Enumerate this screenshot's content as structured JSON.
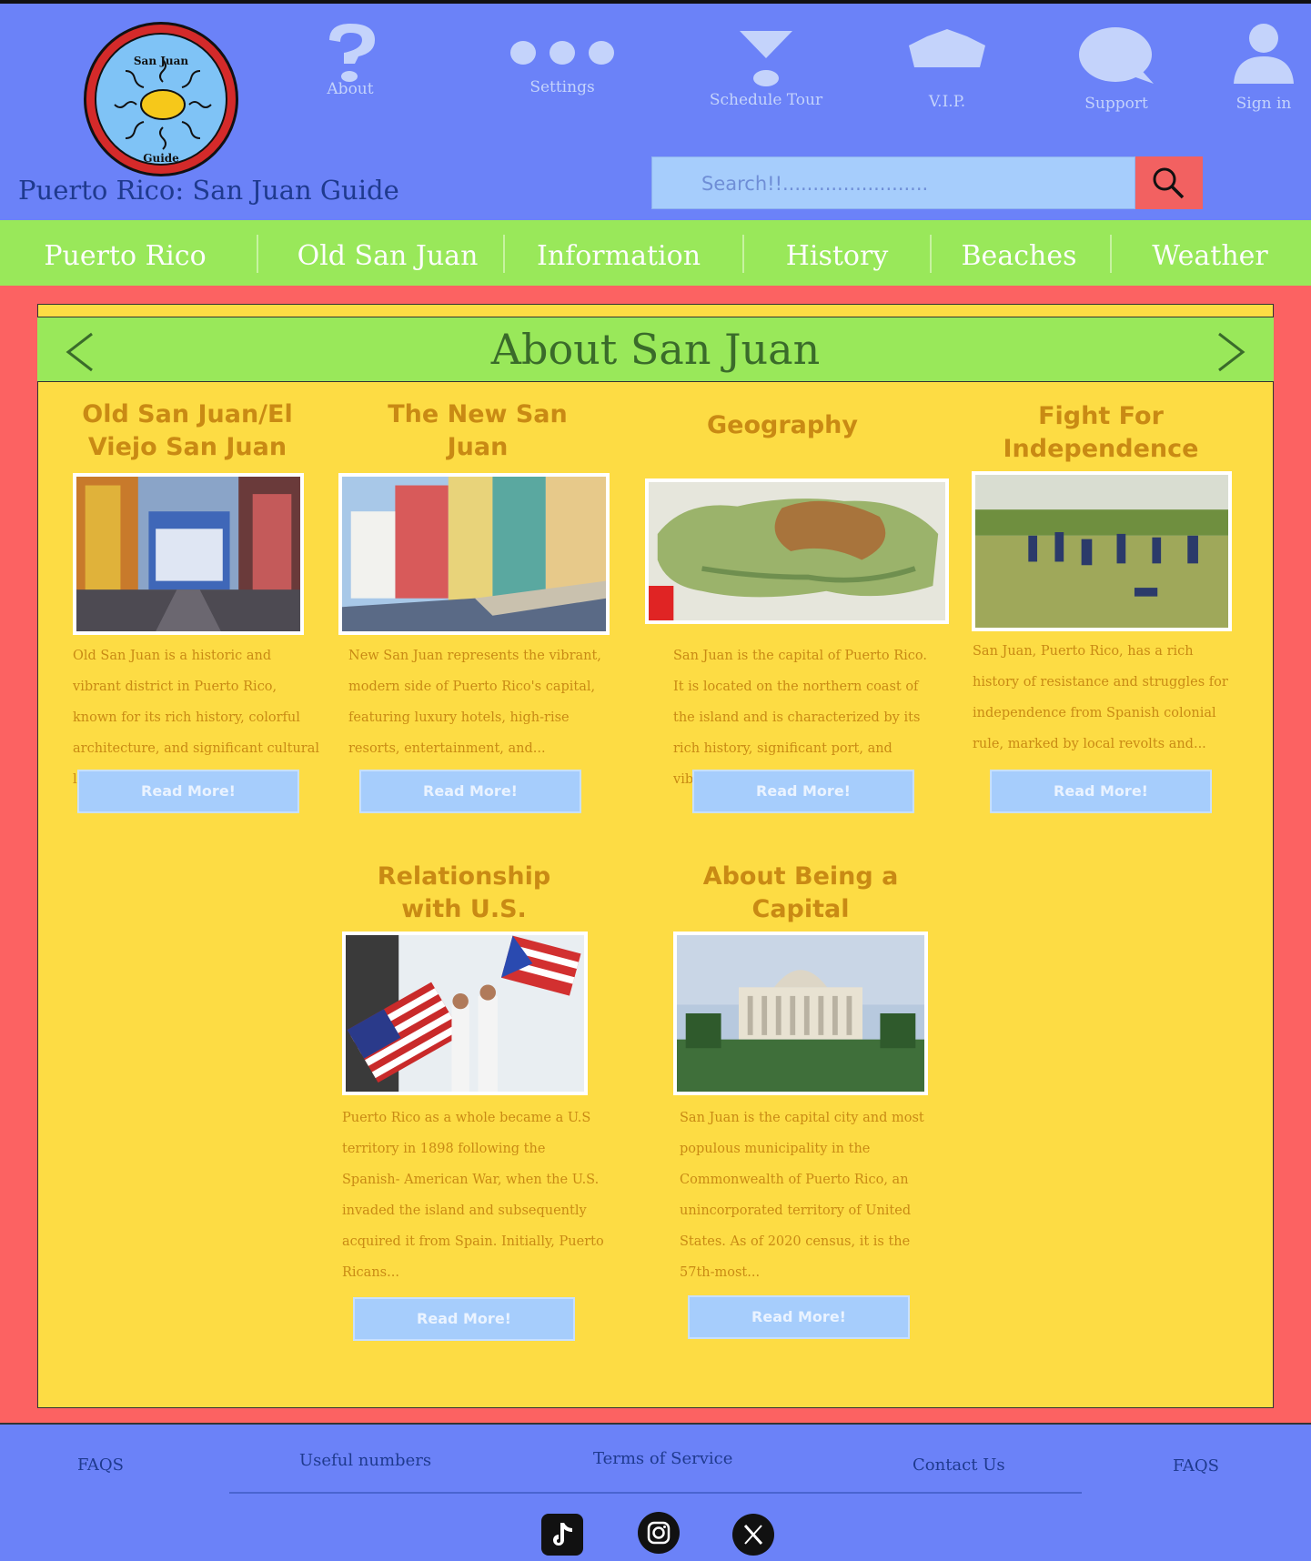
{
  "header": {
    "site_title": "Puerto Rico: San Juan Guide",
    "logo_text_top": "San Juan",
    "logo_text_bottom": "Guide",
    "top_nav": [
      {
        "label": "About",
        "icon": "question-icon"
      },
      {
        "label": "Settings",
        "icon": "ellipsis-icon"
      },
      {
        "label": "Schedule Tour",
        "icon": "tour-icon"
      },
      {
        "label": "V.I.P.",
        "icon": "crown-icon"
      },
      {
        "label": "Support",
        "icon": "chat-bubble-icon"
      },
      {
        "label": "Sign in",
        "icon": "user-icon"
      }
    ],
    "search_placeholder": "Search!!........................"
  },
  "main_nav": [
    "Puerto Rico",
    "Old San Juan",
    "Information",
    "History",
    "Beaches",
    "Weather"
  ],
  "content": {
    "title": "About San Juan",
    "read_more_label": "Read More!",
    "cards": [
      {
        "title": "Old San Juan/El Viejo San Juan",
        "text": "Old San Juan is a historic and vibrant district in Puerto Rico, known for its rich history, colorful architecture, and significant cultural landmarks..."
      },
      {
        "title": "The New San Juan",
        "text": "New San Juan represents the vibrant, modern side of Puerto Rico's capital, featuring luxury hotels, high-rise resorts, entertainment, and..."
      },
      {
        "title": "Geography",
        "text": "San Juan is the capital of Puerto Rico. It is located on the northern coast of the island and is characterized by its rich history, significant port, and vibrant..."
      },
      {
        "title": "Fight For Independence",
        "text": "San Juan, Puerto Rico, has a rich history of resistance and struggles for independence from Spanish colonial rule, marked by local revolts and..."
      },
      {
        "title": "Relationship with U.S.",
        "text": "Puerto Rico as a whole became a U.S territory in 1898 following the Spanish- American War, when the U.S. invaded the island and subsequently acquired it from Spain. Initially, Puerto Ricans..."
      },
      {
        "title": "About Being a Capital",
        "text": "San Juan is the capital city and most populous municipality in the Commonwealth of Puerto Rico, an unincorporated territory of United States. As of 2020 census, it is the 57th-most..."
      }
    ]
  },
  "footer": {
    "links": [
      "FAQS",
      "Useful numbers",
      "Terms of Service",
      "Contact Us",
      "FAQS"
    ],
    "social": [
      "tiktok-icon",
      "instagram-icon",
      "x-icon"
    ]
  },
  "colors": {
    "header_bg": "#6b82f8",
    "nav_green": "#99e85a",
    "panel_yellow": "#fddc44",
    "frame_red": "#fc6262",
    "accent_gold": "#c98a14",
    "button_blue": "#a6cdfc"
  }
}
